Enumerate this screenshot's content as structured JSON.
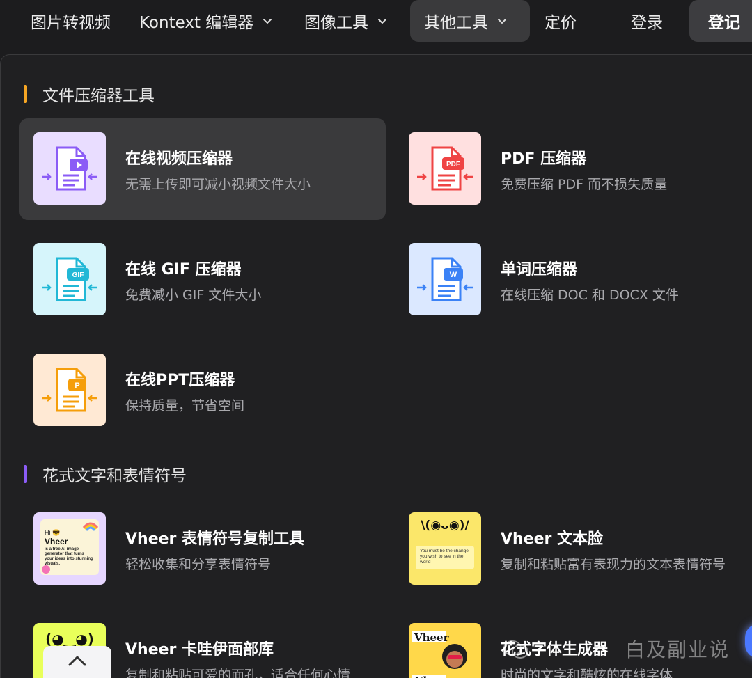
{
  "nav": {
    "items": [
      {
        "label": "图片转视频"
      },
      {
        "label": "Kontext 编辑器"
      },
      {
        "label": "图像工具"
      },
      {
        "label": "其他工具"
      },
      {
        "label": "定价"
      }
    ],
    "login": "登录",
    "signup": "登记"
  },
  "sections": [
    {
      "title": "文件压缩器工具",
      "accent": "#f5a524",
      "tools": [
        {
          "name": "在线视频压缩器",
          "desc": "无需上传即可减小视频文件大小",
          "thumb_color": "#e9ddff",
          "icon_color": "#8b5cf6"
        },
        {
          "name": "PDF 压缩器",
          "desc": "免费压缩 PDF 而不损失质量",
          "thumb_color": "#ffe0e0",
          "icon_color": "#ef4444",
          "badge": "PDF"
        },
        {
          "name": "在线 GIF 压缩器",
          "desc": "免费减小 GIF 文件大小",
          "thumb_color": "#d6f5fb",
          "icon_color": "#22b8d6",
          "badge": "GIF"
        },
        {
          "name": "单词压缩器",
          "desc": "在线压缩 DOC 和 DOCX 文件",
          "thumb_color": "#dbe8ff",
          "icon_color": "#3b82f6",
          "badge": "W"
        },
        {
          "name": "在线PPT压缩器",
          "desc": "保持质量，节省空间",
          "thumb_color": "#ffe9d4",
          "icon_color": "#f59e0b",
          "badge": "P"
        }
      ]
    },
    {
      "title": "花式文字和表情符号",
      "accent": "#8b5cf6",
      "tools": [
        {
          "name": "Vheer 表情符号复制工具",
          "desc": "轻松收集和分享表情符号",
          "thumb_color": "#e6d6ff"
        },
        {
          "name": "Vheer 文本脸",
          "desc": "复制和粘贴富有表现力的文本表情符号",
          "thumb_color": "#fbe76a"
        },
        {
          "name": "Vheer 卡哇伊面部库",
          "desc": "复制和粘贴可爱的面孔，适合任何心情",
          "thumb_color": "#e9ff5a"
        },
        {
          "name": "花式字体生成器",
          "desc": "时尚的文字和酷炫的在线字体",
          "thumb_color": "#ffd84a"
        }
      ]
    }
  ],
  "thumb_text": {
    "emoji_hi": "Hi 😎",
    "emoji_vheer": "Vheer",
    "emoji_body": "is a free AI image generator that turns your ideas into stunning visuals.",
    "textface_top": "\\(◉ᴗ◉)/",
    "textface_mid": "You must be the change you wish to see in the world",
    "kawaii_face": "(◕‿◕)",
    "fancy_word": "Vheer"
  },
  "watermark": "白及副业说"
}
